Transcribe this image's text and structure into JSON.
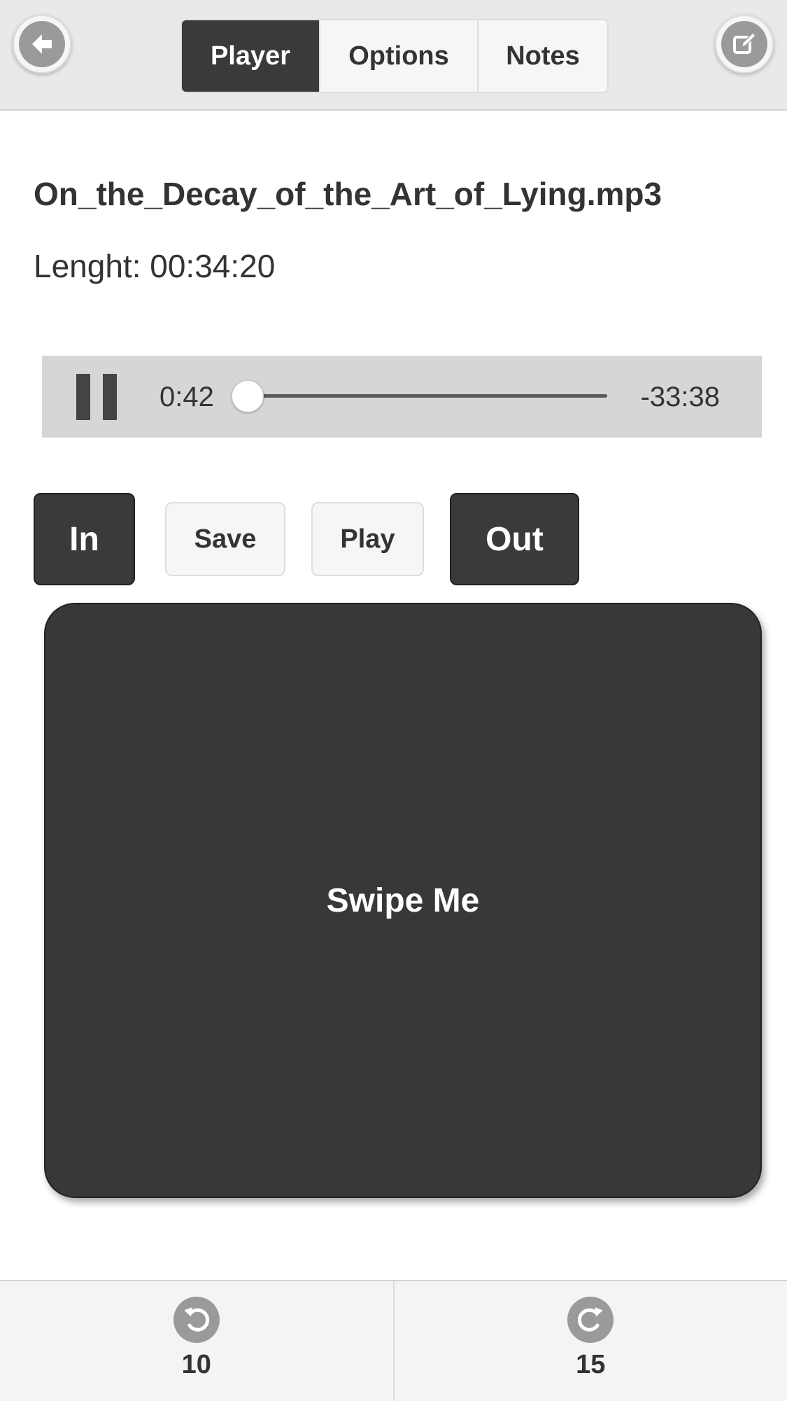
{
  "header": {
    "back_icon": "arrow-left-icon",
    "edit_icon": "edit-icon",
    "tabs": [
      {
        "label": "Player",
        "active": true
      },
      {
        "label": "Options",
        "active": false
      },
      {
        "label": "Notes",
        "active": false
      }
    ]
  },
  "file": {
    "name": "On_the_Decay_of_the_Art_of_Lying.mp3",
    "length_text": "Lenght: 00:34:20"
  },
  "player": {
    "state_icon": "pause-icon",
    "current_time": "0:42",
    "remaining_time": "-33:38",
    "progress": 0.0204
  },
  "controls": {
    "in_label": "In",
    "save_label": "Save",
    "play_label": "Play",
    "out_label": "Out"
  },
  "swipe": {
    "label": "Swipe Me"
  },
  "footer": {
    "rewind_icon": "rewind-icon",
    "rewind_value": "10",
    "forward_icon": "forward-icon",
    "forward_value": "15"
  },
  "colors": {
    "dark": "#3a3a3a",
    "light": "#f6f6f6",
    "header_bg": "#e9e9e9",
    "player_bg": "#d6d6d6"
  }
}
